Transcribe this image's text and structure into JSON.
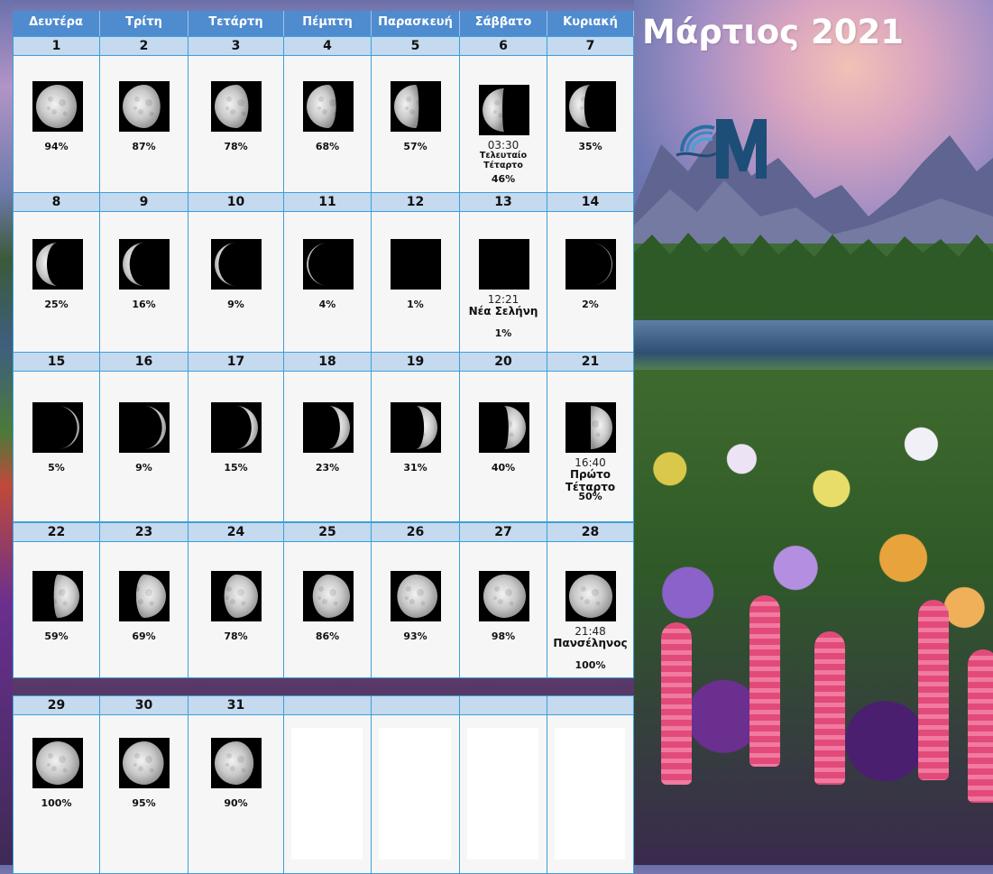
{
  "title": "Μάρτιος 2021",
  "colors": {
    "header_bg": "#4f8bcf",
    "day_number_bg": "#c5d9ef",
    "cell_bg": "#f6f6f6",
    "grid_line": "#3aa0d8"
  },
  "weekdays": [
    "Δευτέρα",
    "Τρίτη",
    "Τετάρτη",
    "Πέμπτη",
    "Παρασκευή",
    "Σάββατο",
    "Κυριακή"
  ],
  "weeks": [
    {
      "days": [
        {
          "day": "1",
          "pct": "94%",
          "fraction": 0.94,
          "waxing": false
        },
        {
          "day": "2",
          "pct": "87%",
          "fraction": 0.87,
          "waxing": false
        },
        {
          "day": "3",
          "pct": "78%",
          "fraction": 0.78,
          "waxing": false
        },
        {
          "day": "4",
          "pct": "68%",
          "fraction": 0.68,
          "waxing": false
        },
        {
          "day": "5",
          "pct": "57%",
          "fraction": 0.57,
          "waxing": false
        },
        {
          "day": "6",
          "pct": "46%",
          "fraction": 0.46,
          "waxing": false,
          "time": "03:30",
          "phase": "Τελευταίο Τέταρτο"
        },
        {
          "day": "7",
          "pct": "35%",
          "fraction": 0.35,
          "waxing": false
        }
      ]
    },
    {
      "days": [
        {
          "day": "8",
          "pct": "25%",
          "fraction": 0.25,
          "waxing": false
        },
        {
          "day": "9",
          "pct": "16%",
          "fraction": 0.16,
          "waxing": false
        },
        {
          "day": "10",
          "pct": "9%",
          "fraction": 0.09,
          "waxing": false
        },
        {
          "day": "11",
          "pct": "4%",
          "fraction": 0.04,
          "waxing": false
        },
        {
          "day": "12",
          "pct": "1%",
          "fraction": 0.01,
          "waxing": false
        },
        {
          "day": "13",
          "pct": "1%",
          "fraction": 0.01,
          "waxing": true,
          "time": "12:21",
          "phase": "Νέα Σελήνη"
        },
        {
          "day": "14",
          "pct": "2%",
          "fraction": 0.02,
          "waxing": true
        }
      ]
    },
    {
      "days": [
        {
          "day": "15",
          "pct": "5%",
          "fraction": 0.05,
          "waxing": true
        },
        {
          "day": "16",
          "pct": "9%",
          "fraction": 0.09,
          "waxing": true
        },
        {
          "day": "17",
          "pct": "15%",
          "fraction": 0.15,
          "waxing": true
        },
        {
          "day": "18",
          "pct": "23%",
          "fraction": 0.23,
          "waxing": true
        },
        {
          "day": "19",
          "pct": "31%",
          "fraction": 0.31,
          "waxing": true
        },
        {
          "day": "20",
          "pct": "40%",
          "fraction": 0.4,
          "waxing": true
        },
        {
          "day": "21",
          "pct": "50%",
          "fraction": 0.5,
          "waxing": true,
          "time": "16:40",
          "phase": "Πρώτο Τέταρτο"
        }
      ]
    },
    {
      "days": [
        {
          "day": "22",
          "pct": "59%",
          "fraction": 0.59,
          "waxing": true
        },
        {
          "day": "23",
          "pct": "69%",
          "fraction": 0.69,
          "waxing": true
        },
        {
          "day": "24",
          "pct": "78%",
          "fraction": 0.78,
          "waxing": true
        },
        {
          "day": "25",
          "pct": "86%",
          "fraction": 0.86,
          "waxing": true
        },
        {
          "day": "26",
          "pct": "93%",
          "fraction": 0.93,
          "waxing": true
        },
        {
          "day": "27",
          "pct": "98%",
          "fraction": 0.98,
          "waxing": true
        },
        {
          "day": "28",
          "pct": "100%",
          "fraction": 1.0,
          "waxing": true,
          "time": "21:48",
          "phase": "Πανσέληνος"
        }
      ]
    },
    {
      "days": [
        {
          "day": "29",
          "pct": "100%",
          "fraction": 1.0,
          "waxing": false
        },
        {
          "day": "30",
          "pct": "95%",
          "fraction": 0.95,
          "waxing": false
        },
        {
          "day": "31",
          "pct": "90%",
          "fraction": 0.9,
          "waxing": false
        },
        {
          "day": ""
        },
        {
          "day": ""
        },
        {
          "day": ""
        },
        {
          "day": ""
        }
      ]
    }
  ]
}
